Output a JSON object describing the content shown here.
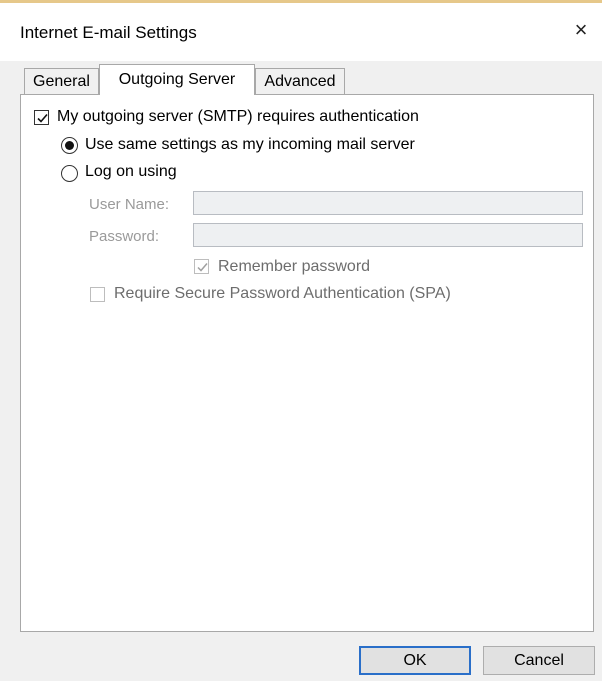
{
  "window": {
    "title": "Internet E-mail Settings",
    "close_glyph": "×"
  },
  "tabs": [
    {
      "label": "General"
    },
    {
      "label": "Outgoing Server",
      "active": true
    },
    {
      "label": "Advanced"
    }
  ],
  "outgoing": {
    "requires_auth": {
      "label": "My outgoing server (SMTP) requires authentication",
      "checked": true
    },
    "same_settings": {
      "label": "Use same settings as my incoming mail server",
      "selected": true
    },
    "log_on": {
      "label": "Log on using",
      "selected": false
    },
    "user_name": {
      "label": "User Name:",
      "value": ""
    },
    "password": {
      "label": "Password:",
      "value": ""
    },
    "remember": {
      "label": "Remember password",
      "checked": true,
      "enabled": false
    },
    "spa": {
      "label": "Require Secure Password Authentication (SPA)",
      "checked": false,
      "enabled": false
    }
  },
  "buttons": {
    "ok": "OK",
    "cancel": "Cancel"
  },
  "colors": {
    "default_button_border": "#2a6fc9",
    "panel_bg": "#ffffff",
    "dialog_bg": "#f0f0f0"
  }
}
